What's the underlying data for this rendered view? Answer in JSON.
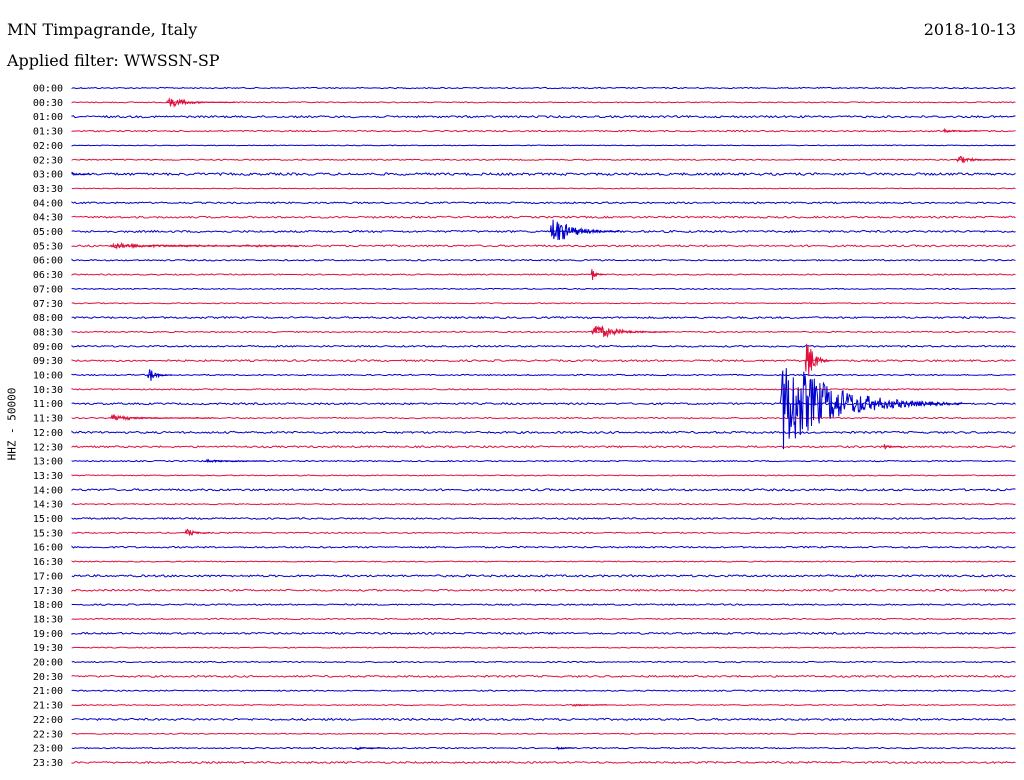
{
  "header": {
    "station": "MN Timpagrande, Italy",
    "date": "2018-10-13",
    "filter": "Applied filter: WWSSN-SP"
  },
  "chart_data": {
    "type": "line",
    "title": "MN Timpagrande, Italy",
    "ylabel": "HHZ - 50000",
    "colors": [
      "#0000cc",
      "#e0103c"
    ],
    "times": [
      "00:00",
      "00:30",
      "01:00",
      "01:30",
      "02:00",
      "02:30",
      "03:00",
      "03:30",
      "04:00",
      "04:30",
      "05:00",
      "05:30",
      "06:00",
      "06:30",
      "07:00",
      "07:30",
      "08:00",
      "08:30",
      "09:00",
      "09:30",
      "10:00",
      "10:30",
      "11:00",
      "11:30",
      "12:00",
      "12:30",
      "13:00",
      "13:30",
      "14:00",
      "14:30",
      "15:00",
      "15:30",
      "16:00",
      "16:30",
      "17:00",
      "17:30",
      "18:00",
      "18:30",
      "19:00",
      "19:30",
      "20:00",
      "20:30",
      "21:00",
      "21:30",
      "22:00",
      "22:30",
      "23:00",
      "23:30"
    ],
    "noise": [
      0.6,
      0.5,
      1.0,
      0.7,
      0.4,
      0.6,
      1.2,
      0.4,
      0.8,
      0.9,
      1.0,
      0.9,
      0.7,
      0.6,
      0.5,
      0.5,
      0.9,
      0.6,
      0.8,
      0.9,
      0.6,
      0.6,
      0.9,
      0.6,
      1.0,
      0.9,
      0.6,
      0.5,
      1.0,
      0.5,
      0.8,
      0.6,
      0.8,
      0.5,
      1.0,
      0.9,
      0.7,
      0.6,
      0.9,
      0.5,
      0.6,
      0.9,
      0.6,
      0.5,
      1.0,
      0.5,
      0.6,
      0.9
    ],
    "events": [
      {
        "row": 1,
        "minute": 3.0,
        "amp": 6,
        "dur": 2.2
      },
      {
        "row": 3,
        "minute": 27.7,
        "amp": 2,
        "dur": 1.2
      },
      {
        "row": 5,
        "minute": 28.1,
        "amp": 5,
        "dur": 1.6
      },
      {
        "row": 6,
        "minute": 0.0,
        "amp": 3,
        "dur": 0.6
      },
      {
        "row": 10,
        "minute": 15.2,
        "amp": 18,
        "dur": 2.2
      },
      {
        "row": 11,
        "minute": 1.2,
        "amp": 3,
        "dur": 6.0
      },
      {
        "row": 13,
        "minute": 16.5,
        "amp": 8,
        "dur": 0.5
      },
      {
        "row": 17,
        "minute": 16.5,
        "amp": 10,
        "dur": 2.5
      },
      {
        "row": 19,
        "minute": 23.3,
        "amp": 34,
        "dur": 0.8
      },
      {
        "row": 20,
        "minute": 2.4,
        "amp": 11,
        "dur": 0.8
      },
      {
        "row": 22,
        "minute": 22.5,
        "amp": 54,
        "dur": 5.8
      },
      {
        "row": 23,
        "minute": 1.2,
        "amp": 3,
        "dur": 3.4
      },
      {
        "row": 25,
        "minute": 25.8,
        "amp": 3,
        "dur": 0.6
      },
      {
        "row": 26,
        "minute": 4.2,
        "amp": 2,
        "dur": 2.0
      },
      {
        "row": 31,
        "minute": 3.6,
        "amp": 6,
        "dur": 0.8
      },
      {
        "row": 43,
        "minute": 15.9,
        "amp": 2,
        "dur": 1.2
      },
      {
        "row": 46,
        "minute": 9.0,
        "amp": 2,
        "dur": 1.0
      },
      {
        "row": 46,
        "minute": 15.4,
        "amp": 2,
        "dur": 0.6
      }
    ]
  }
}
